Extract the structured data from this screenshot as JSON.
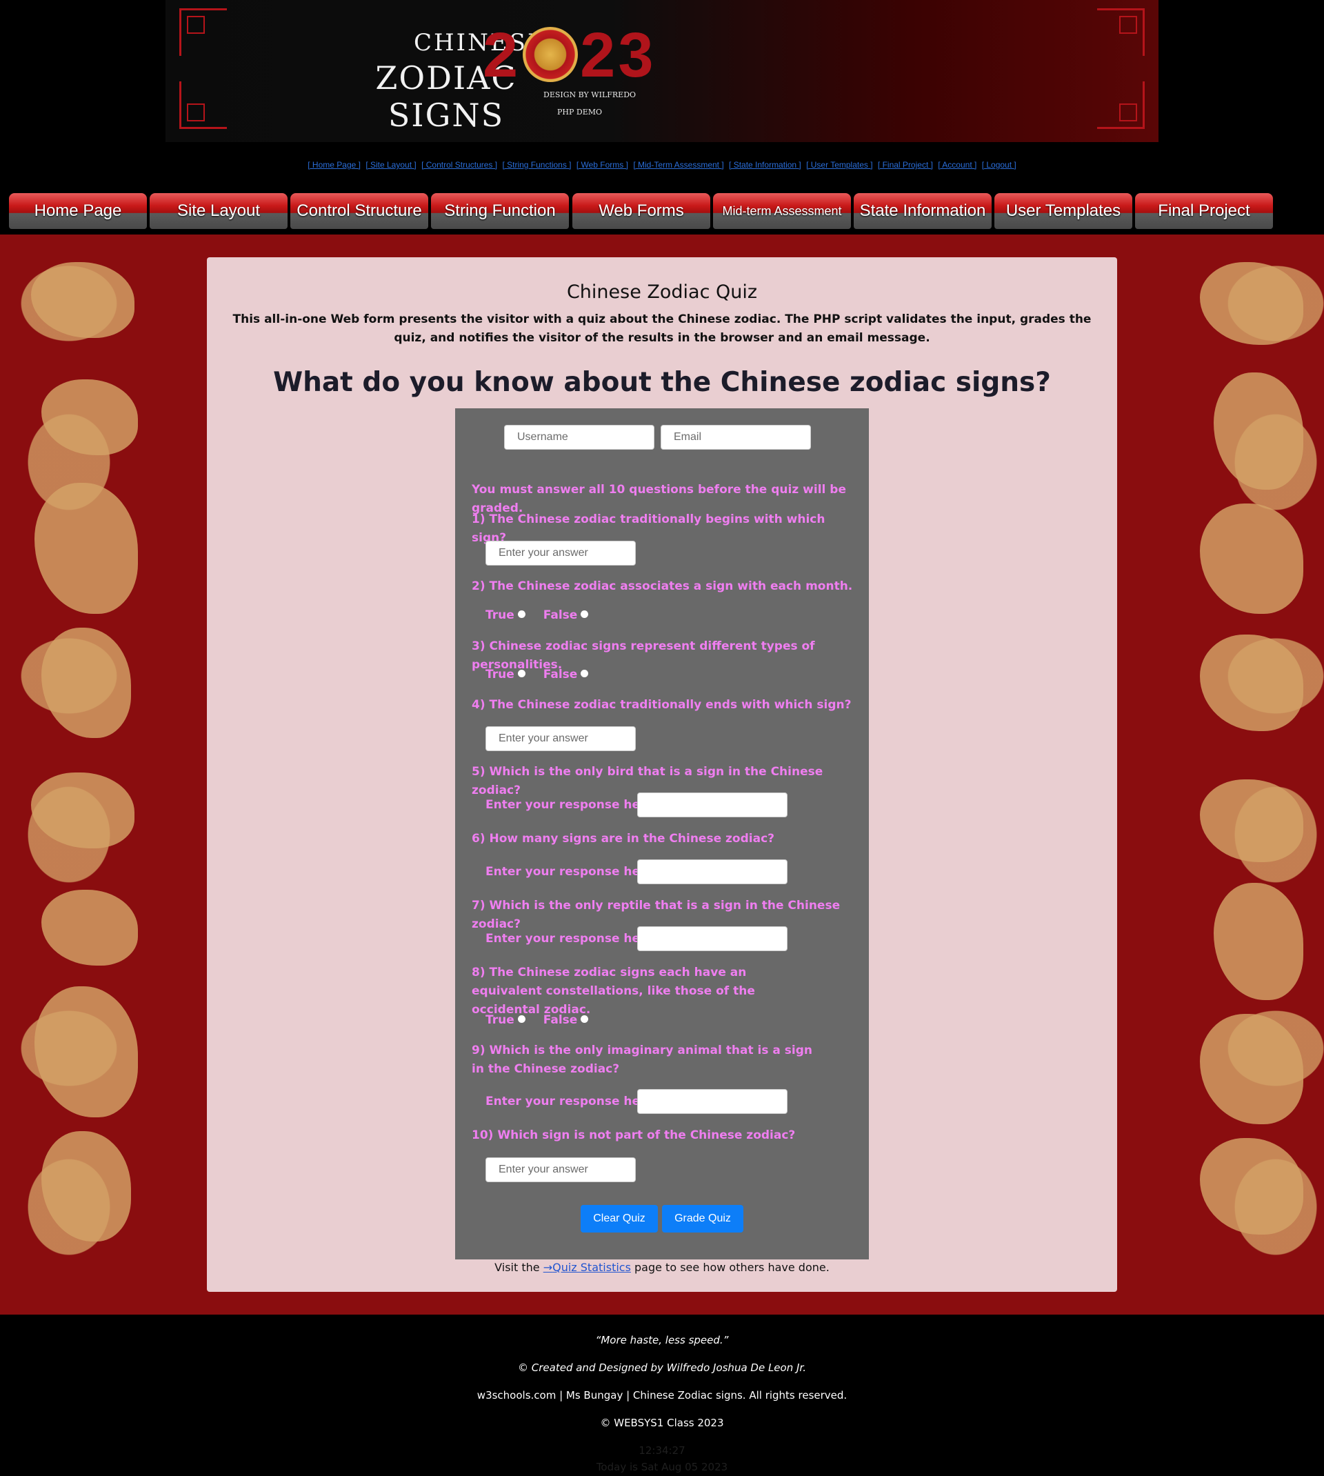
{
  "banner": {
    "line1": "CHINESE",
    "line2": "ZODIAC SIGNS",
    "year_left": "2",
    "year_right": "23",
    "credit": "DESIGN BY WILFREDO",
    "tag": "PHP DEMO"
  },
  "top_links": [
    "[ Home Page ]",
    "[ Site Layout ]",
    "[ Control Structures ]",
    "[ String Functions ]",
    "[ Web  Forms ]",
    "[ Mid-Term Assessment ]",
    "[ State Information ]",
    "[ User Templates ]",
    "[ Final Project ]",
    "[ Account ]",
    "[ Logout ]"
  ],
  "nav": [
    {
      "label": "Home Page"
    },
    {
      "label": "Site Layout"
    },
    {
      "label": "Control Structure"
    },
    {
      "label": "String Function"
    },
    {
      "label": "Web Forms"
    },
    {
      "label": "Mid-term Assessment"
    },
    {
      "label": "State Information"
    },
    {
      "label": "User Templates"
    },
    {
      "label": "Final Project"
    }
  ],
  "main": {
    "title": "Chinese Zodiac Quiz",
    "intro": "This all-in-one Web form presents the visitor with a quiz about the Chinese zodiac. The PHP script validates the input, grades the quiz, and notifies the visitor of the results in the browser and an email message.",
    "heading": "What do you know about the Chinese zodiac signs?"
  },
  "form": {
    "username_placeholder": "Username",
    "email_placeholder": "Email",
    "notice": "You must answer all 10 questions before the quiz will be graded.",
    "answer_placeholder": "Enter your answer",
    "response_label": "Enter your response here:",
    "true_label": "True",
    "false_label": "False",
    "questions": [
      "1) The Chinese zodiac traditionally begins with which sign?",
      "2) The Chinese zodiac associates a sign with each month.",
      "3) Chinese zodiac signs represent different types of personalities.",
      "4) The Chinese zodiac traditionally ends with which sign?",
      "5) Which is the only bird that is a sign in the Chinese zodiac?",
      "6) How many signs are in the Chinese zodiac?",
      "7) Which is the only reptile that is a sign in the Chinese zodiac?",
      "8) The Chinese zodiac signs each have an equivalent constellations, like those of the occidental zodiac.",
      "9) Which is the only imaginary animal that is a sign in the Chinese zodiac?",
      "10) Which sign is not part of the Chinese zodiac?"
    ],
    "clear_label": "Clear Quiz",
    "grade_label": "Grade Quiz",
    "stats_before": "Visit the ",
    "stats_link": "Quiz Statistics",
    "stats_after": " page to see how others have done."
  },
  "footer": {
    "quote": "“More haste, less speed.”",
    "credit": "© Created and Designed by Wilfredo Joshua De Leon Jr.",
    "sources": "w3schools.com | Ms Bungay | Chinese Zodiac signs. All rights reserved.",
    "class": "© WEBSYS1 Class 2023",
    "time": "12:34:27",
    "date": "Today is Sat Aug 05 2023"
  },
  "colors": {
    "question_text": "#ef7ef0",
    "panel": "#696969",
    "button": "#0d7ef8",
    "backdrop": "#8a0d0f"
  }
}
